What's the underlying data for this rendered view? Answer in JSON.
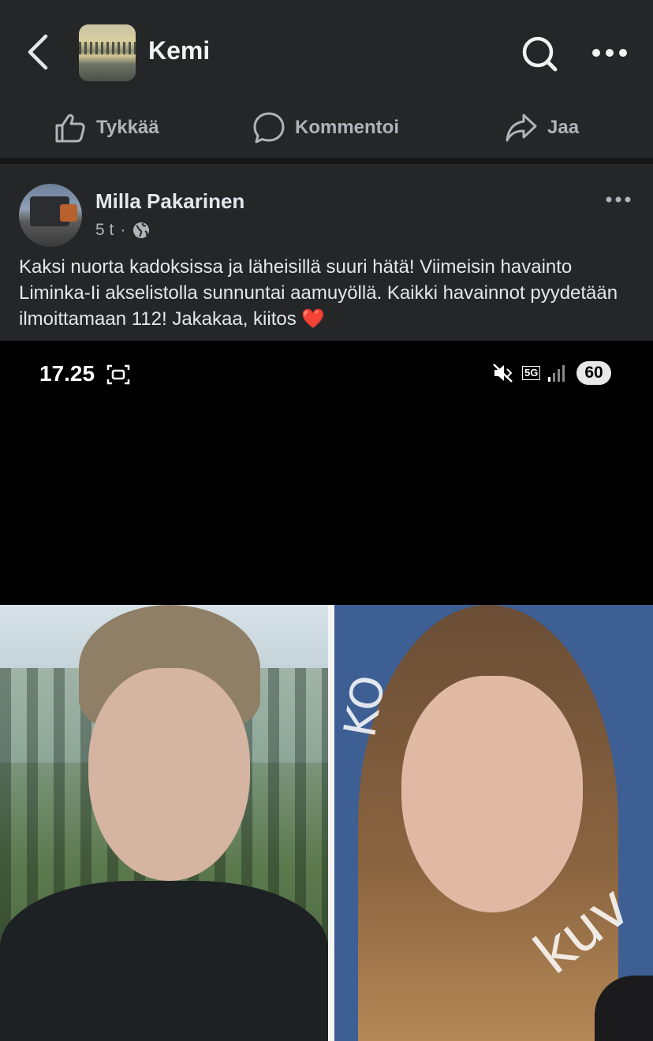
{
  "header": {
    "group_name": "Kemi"
  },
  "actions": {
    "like_label": "Tykkää",
    "comment_label": "Kommentoi",
    "share_label": "Jaa"
  },
  "post": {
    "author": "Milla Pakarinen",
    "time": "5 t",
    "separator": "·",
    "text": "Kaksi nuorta kadoksissa ja läheisillä suuri hätä! Viimeisin havainto Liminka-Ii akselistolla sunnuntai aamuyöllä. Kaikki havainnot pyydetään ilmoittamaan 112! Jakakaa, kiitos ❤️"
  },
  "screenshot": {
    "time": "17.25",
    "network": "5G",
    "battery": "60"
  },
  "photos": {
    "watermark_top": "KO",
    "watermark_bottom": "kuv"
  },
  "icons": {
    "back": "chevron-left-icon",
    "search": "search-icon",
    "more": "more-horizontal-icon",
    "like": "thumbs-up-icon",
    "comment": "comment-bubble-icon",
    "share": "share-arrow-icon",
    "audience": "globe-icon"
  },
  "colors": {
    "background": "#252628",
    "text_primary": "#e4e6eb",
    "text_secondary": "#b0b3b8",
    "divider": "#151516"
  }
}
